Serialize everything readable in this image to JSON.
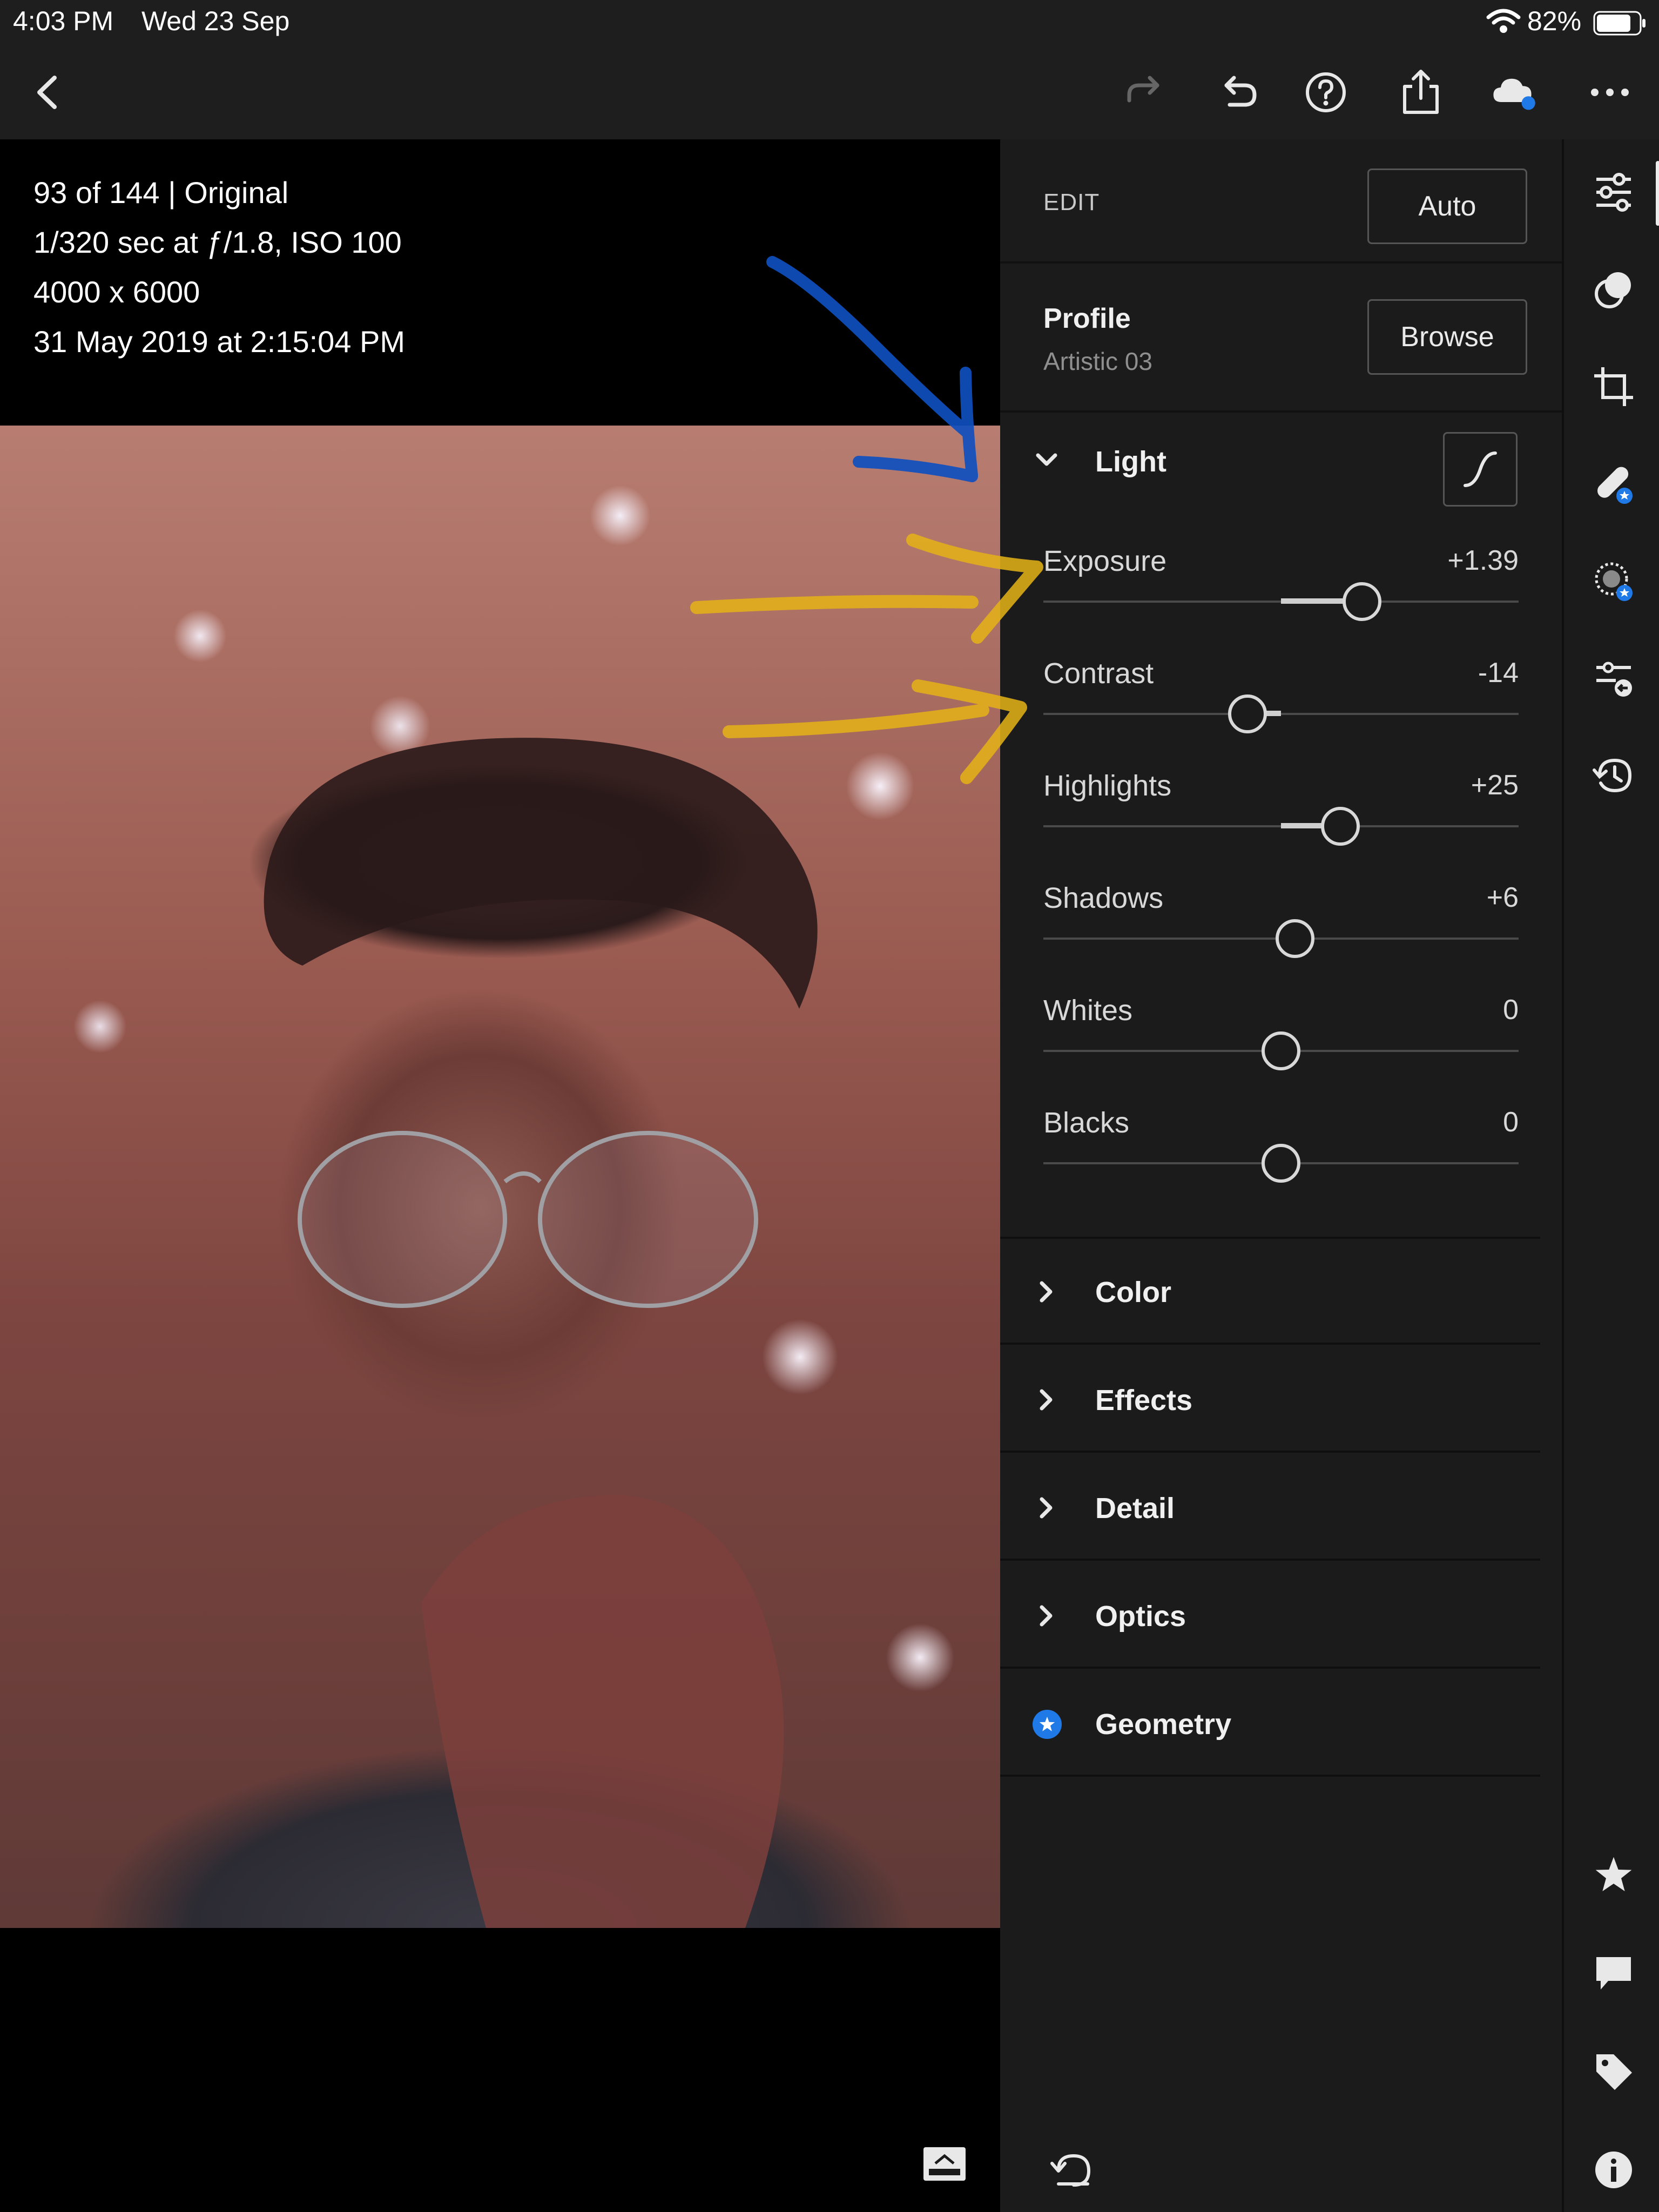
{
  "status_bar": {
    "time": "4:03 PM",
    "date": "Wed 23 Sep",
    "battery_percent": "82%",
    "battery_level": 0.82
  },
  "toolbar": {
    "icons": [
      "back-chevron-icon",
      "redo-icon",
      "undo-icon",
      "help-icon",
      "share-icon",
      "cloud-sync-icon",
      "more-icon"
    ]
  },
  "photo_info": {
    "line1": "93 of 144 | Original",
    "line2": "1/320 sec at ƒ/1.8, ISO 100",
    "line3": "4000 x 6000",
    "line4": "31 May 2019 at 2:15:04 PM"
  },
  "edit_panel": {
    "edit_label": "EDIT",
    "auto_label": "Auto",
    "profile_title": "Profile",
    "profile_value": "Artistic 03",
    "browse_label": "Browse",
    "light_title": "Light",
    "sliders": [
      {
        "label": "Exposure",
        "value": "+1.39",
        "level": 0.67
      },
      {
        "label": "Contrast",
        "value": "-14",
        "level": 0.43
      },
      {
        "label": "Highlights",
        "value": "+25",
        "level": 0.625
      },
      {
        "label": "Shadows",
        "value": "+6",
        "level": 0.53
      },
      {
        "label": "Whites",
        "value": "0",
        "level": 0.5
      },
      {
        "label": "Blacks",
        "value": "0",
        "level": 0.5
      }
    ],
    "groups": [
      "Color",
      "Effects",
      "Detail",
      "Optics",
      "Geometry"
    ]
  },
  "rail": {
    "icons": [
      "edit-sliders-icon",
      "presets-icon",
      "crop-icon",
      "healing-icon",
      "masking-icon",
      "versions-icon",
      "history-icon",
      "star-icon",
      "comment-icon",
      "tag-icon",
      "info-icon"
    ]
  },
  "colors": {
    "panel_bg": "#1b1b1b",
    "accent_blue": "#1f7ae8",
    "annotation_blue": "#0f4fbf",
    "annotation_yellow": "#e5b316"
  }
}
